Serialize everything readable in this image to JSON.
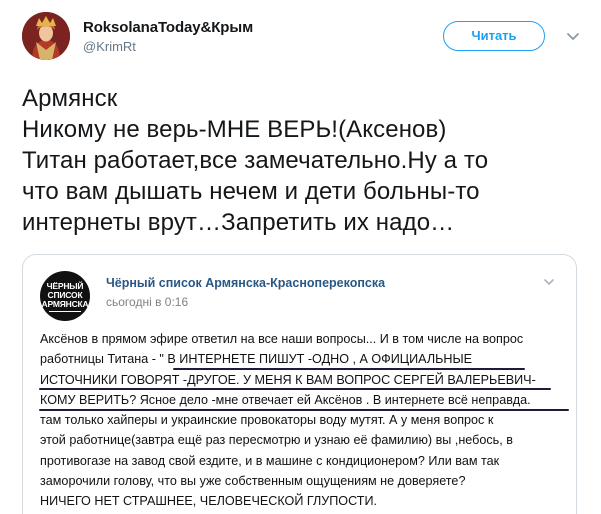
{
  "tweet": {
    "author": {
      "display_name": "RoksolanaToday&Крым",
      "handle": "@KrimRt"
    },
    "follow_button_label": "Читать",
    "text_lines": [
      "Армянск",
      "Никому не верь-МНЕ ВЕРЬ!(Аксенов)",
      "Титан работает,все замечательно.Ну а то",
      "что вам дышать нечем и дети больны-то",
      "интернеты врут…Запретить их надо…"
    ]
  },
  "screenshot": {
    "group": {
      "logo_lines": [
        "ЧЁРНЫЙ",
        "СПИСОК",
        "АРМЯНСКА"
      ],
      "name": "Чёрный список Армянска-Красноперекопска",
      "time": "сьогодні в 0:16"
    },
    "post_lines": [
      "Аксёнов в прямом эфире ответил на все наши вопросы... И в том числе на вопрос",
      "работницы Титана - \" В ИНТЕРНЕТЕ ПИШУТ -ОДНО , А ОФИЦИАЛЬНЫЕ",
      "ИСТОЧНИКИ ГОВОРЯТ -ДРУГОЕ. У МЕНЯ К ВАМ ВОПРОС СЕРГЕЙ ВАЛЕРЬЕВИЧ-",
      "КОМУ ВЕРИТЬ? Ясное дело -мне отвечает ей Аксёнов . В интернете всё неправда.",
      "там только хайперы и украинские провокаторы воду мутят. А у меня вопрос к",
      "этой работнице(завтра ещё раз пересмотрю и узнаю её фамилию) вы ,небось, в",
      "противогазе на завод свой ездите, и в машине с кондиционером? Или вам так",
      "заморочили голову, что вы уже собственным ощущениям не доверяете?",
      "НИЧЕГО НЕТ СТРАШНЕЕ, ЧЕЛОВЕЧЕСКОЙ ГЛУПОСТИ."
    ]
  },
  "colors": {
    "twitter_blue": "#1da1f2",
    "vk_link": "#2a5885",
    "muted": "#657786"
  },
  "icons": [
    "avatar-portrait",
    "chevron-down-icon",
    "group-logo",
    "more-icon"
  ]
}
